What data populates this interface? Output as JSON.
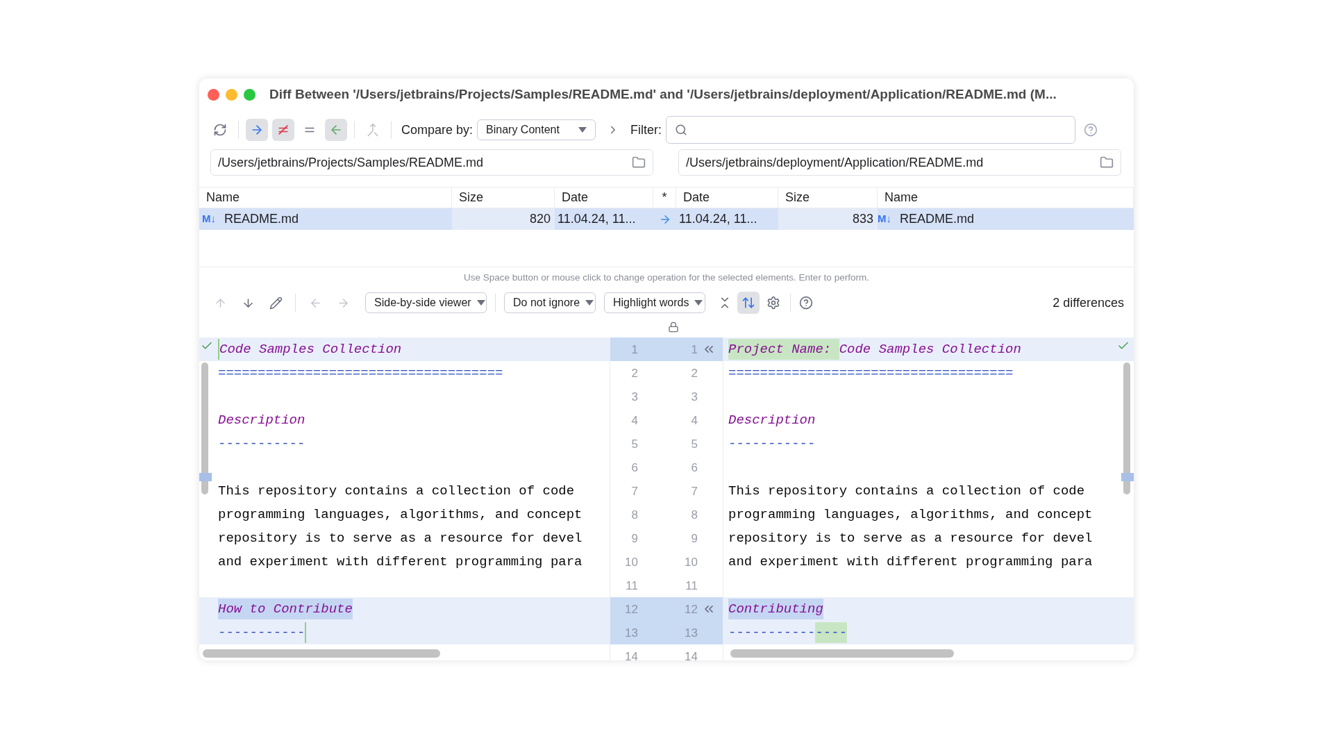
{
  "window": {
    "title": "Diff Between '/Users/jetbrains/Projects/Samples/README.md' and '/Users/jetbrains/deployment/Application/README.md (M..."
  },
  "toolbar": {
    "buttons": [
      {
        "kind": "refresh",
        "selected": false,
        "disabled": false
      },
      {
        "kind": "right",
        "selected": true,
        "disabled": false
      },
      {
        "kind": "not_equal",
        "selected": true,
        "disabled": false
      },
      {
        "kind": "equal",
        "selected": false,
        "disabled": false
      },
      {
        "kind": "left",
        "selected": true,
        "disabled": false
      },
      {
        "kind": "merge",
        "selected": false,
        "disabled": true
      }
    ],
    "compare_label": "Compare by:",
    "compare_value": "Binary Content",
    "filter_label": "Filter:"
  },
  "paths": {
    "left": "/Users/jetbrains/Projects/Samples/README.md",
    "right": "/Users/jetbrains/deployment/Application/README.md"
  },
  "table": {
    "columns": [
      "Name",
      "Size",
      "Date",
      "*",
      "Date",
      "Size",
      "Name"
    ],
    "rows": [
      {
        "selected": true,
        "left_icon": "M↓",
        "left_name": "README.md",
        "left_size": "820",
        "left_date": "11.04.24, 11...",
        "right_date": "11.04.24, 11...",
        "right_size": "833",
        "right_icon": "M↓",
        "right_name": "README.md"
      }
    ]
  },
  "hint": "Use Space button or mouse click to change operation for the selected elements. Enter to perform.",
  "diff_toolbar": {
    "buttons": [
      {
        "kind": "up",
        "disabled": true
      },
      {
        "kind": "down",
        "disabled": false
      },
      {
        "kind": "edit",
        "disabled": false
      },
      {
        "kind": "back",
        "disabled": true
      },
      {
        "kind": "forward",
        "disabled": true
      }
    ],
    "dropdowns": [
      "Side-by-side viewer",
      "Do not ignore",
      "Highlight words"
    ],
    "sync_scroll": {
      "selected": true
    },
    "differences": "2 differences"
  },
  "diff": {
    "rows": [
      {
        "l": "1",
        "r": "1",
        "changed": true,
        "arrow": true,
        "kind": "heading",
        "left": [
          {
            "kind": "insertion"
          },
          {
            "text": "Code Samples Collection",
            "kind": "plain"
          }
        ],
        "right": [
          {
            "text": "Project Name: ",
            "kind": "inserted"
          },
          {
            "text": "Code Samples Collection",
            "kind": "plain"
          }
        ]
      },
      {
        "l": "2",
        "r": "2",
        "changed": false,
        "arrow": false,
        "kind": "rule",
        "left": [
          {
            "text": "====================================",
            "kind": "plain"
          }
        ],
        "right": [
          {
            "text": "====================================",
            "kind": "plain"
          }
        ]
      },
      {
        "l": "3",
        "r": "3",
        "changed": false,
        "arrow": false
      },
      {
        "l": "4",
        "r": "4",
        "changed": false,
        "arrow": false,
        "kind": "heading",
        "left": [
          {
            "text": "Description",
            "kind": "plain"
          }
        ],
        "right": [
          {
            "text": "Description",
            "kind": "plain"
          }
        ]
      },
      {
        "l": "5",
        "r": "5",
        "changed": false,
        "arrow": false,
        "kind": "rule",
        "left": [
          {
            "text": "-----------",
            "kind": "plain"
          }
        ],
        "right": [
          {
            "text": "-----------",
            "kind": "plain"
          }
        ]
      },
      {
        "l": "6",
        "r": "6",
        "changed": false,
        "arrow": false
      },
      {
        "l": "7",
        "r": "7",
        "changed": false,
        "arrow": false,
        "kind": "text",
        "left": [
          {
            "text": "This repository contains a collection of code",
            "kind": "plain"
          }
        ],
        "right": [
          {
            "text": "This repository contains a collection of code",
            "kind": "plain"
          }
        ]
      },
      {
        "l": "8",
        "r": "8",
        "changed": false,
        "arrow": false,
        "kind": "text",
        "left": [
          {
            "text": "programming languages, algorithms, and concept",
            "kind": "plain"
          }
        ],
        "right": [
          {
            "text": "programming languages, algorithms, and concept",
            "kind": "plain"
          }
        ]
      },
      {
        "l": "9",
        "r": "9",
        "changed": false,
        "arrow": false,
        "kind": "text",
        "left": [
          {
            "text": "repository is to serve as a resource for devel",
            "kind": "plain"
          }
        ],
        "right": [
          {
            "text": "repository is to serve as a resource for devel",
            "kind": "plain"
          }
        ]
      },
      {
        "l": "10",
        "r": "10",
        "changed": false,
        "arrow": false,
        "kind": "text",
        "left": [
          {
            "text": "and experiment with different programming para",
            "kind": "plain"
          }
        ],
        "right": [
          {
            "text": "and experiment with different programming para",
            "kind": "plain"
          }
        ]
      },
      {
        "l": "11",
        "r": "11",
        "changed": false,
        "arrow": false
      },
      {
        "l": "12",
        "r": "12",
        "changed": true,
        "arrow": true,
        "kind": "heading",
        "left": [
          {
            "text": "How to Contribute",
            "kind": "changed"
          }
        ],
        "right": [
          {
            "text": "Contributing",
            "kind": "changed"
          }
        ]
      },
      {
        "l": "13",
        "r": "13",
        "changed": true,
        "arrow": false,
        "kind": "rule",
        "left": [
          {
            "text": "-----------",
            "kind": "plain"
          },
          {
            "kind": "insertion"
          }
        ],
        "right": [
          {
            "text": "-----------",
            "kind": "plain"
          },
          {
            "text": "----",
            "kind": "inserted"
          }
        ]
      },
      {
        "l": "14",
        "r": "14",
        "changed": false,
        "arrow": false
      }
    ]
  }
}
